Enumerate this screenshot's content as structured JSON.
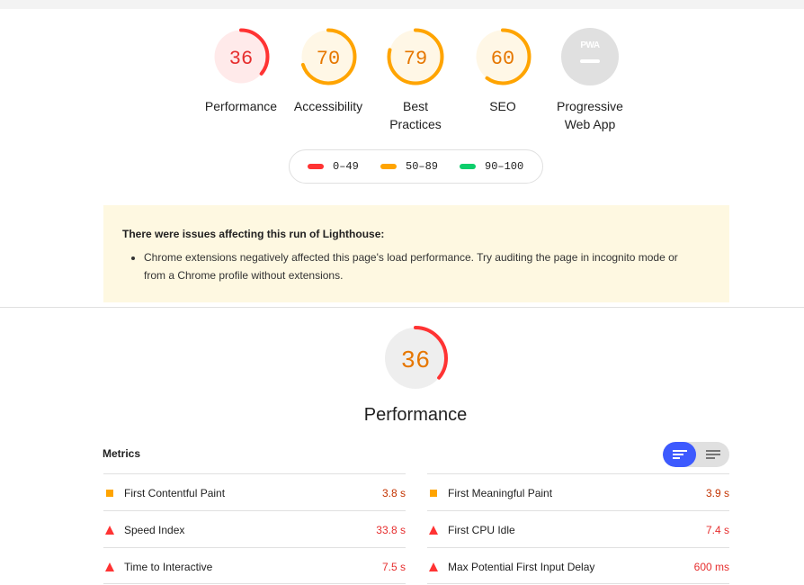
{
  "colors": {
    "fail": "#ff3333",
    "fail_bg": "#ffeaea",
    "average": "#ffa400",
    "average_bg": "#fff7e6",
    "pass": "#0cce6b",
    "na": "#e0e0e0",
    "na_text": "#9e9e9e",
    "accent": "#3d5afe",
    "value_fail": "#e62e2e",
    "value_average": "#c33300"
  },
  "categories": [
    {
      "label": "Performance",
      "score": "36",
      "fraction": 0.36,
      "rating": "fail"
    },
    {
      "label": "Accessibility",
      "score": "70",
      "fraction": 0.7,
      "rating": "average"
    },
    {
      "label": "Best Practices",
      "score": "79",
      "fraction": 0.79,
      "rating": "average"
    },
    {
      "label": "SEO",
      "score": "60",
      "fraction": 0.6,
      "rating": "average"
    },
    {
      "label": "Progressive Web App",
      "score": "",
      "fraction": 0,
      "rating": "na",
      "badge": "PWA"
    }
  ],
  "legend": [
    {
      "range": "0–49",
      "rating": "fail"
    },
    {
      "range": "50–89",
      "rating": "average"
    },
    {
      "range": "90–100",
      "rating": "pass"
    }
  ],
  "warning": {
    "title": "There were issues affecting this run of Lighthouse:",
    "items": [
      "Chrome extensions negatively affected this page's load performance. Try auditing the page in incognito mode or from a Chrome profile without extensions."
    ]
  },
  "performance": {
    "score": "36",
    "fraction": 0.36,
    "title": "Performance"
  },
  "metrics": {
    "heading": "Metrics",
    "toggle": {
      "active": "list-view-icon",
      "inactive": "text-view-icon"
    },
    "left": [
      {
        "label": "First Contentful Paint",
        "value": "3.8 s",
        "rating": "average",
        "icon": "square-icon"
      },
      {
        "label": "Speed Index",
        "value": "33.8 s",
        "rating": "fail",
        "icon": "triangle-icon"
      },
      {
        "label": "Time to Interactive",
        "value": "7.5 s",
        "rating": "fail",
        "icon": "triangle-icon"
      }
    ],
    "right": [
      {
        "label": "First Meaningful Paint",
        "value": "3.9 s",
        "rating": "average",
        "icon": "square-icon"
      },
      {
        "label": "First CPU Idle",
        "value": "7.4 s",
        "rating": "fail",
        "icon": "triangle-icon"
      },
      {
        "label": "Max Potential First Input Delay",
        "value": "600 ms",
        "rating": "fail",
        "icon": "triangle-icon"
      }
    ]
  }
}
